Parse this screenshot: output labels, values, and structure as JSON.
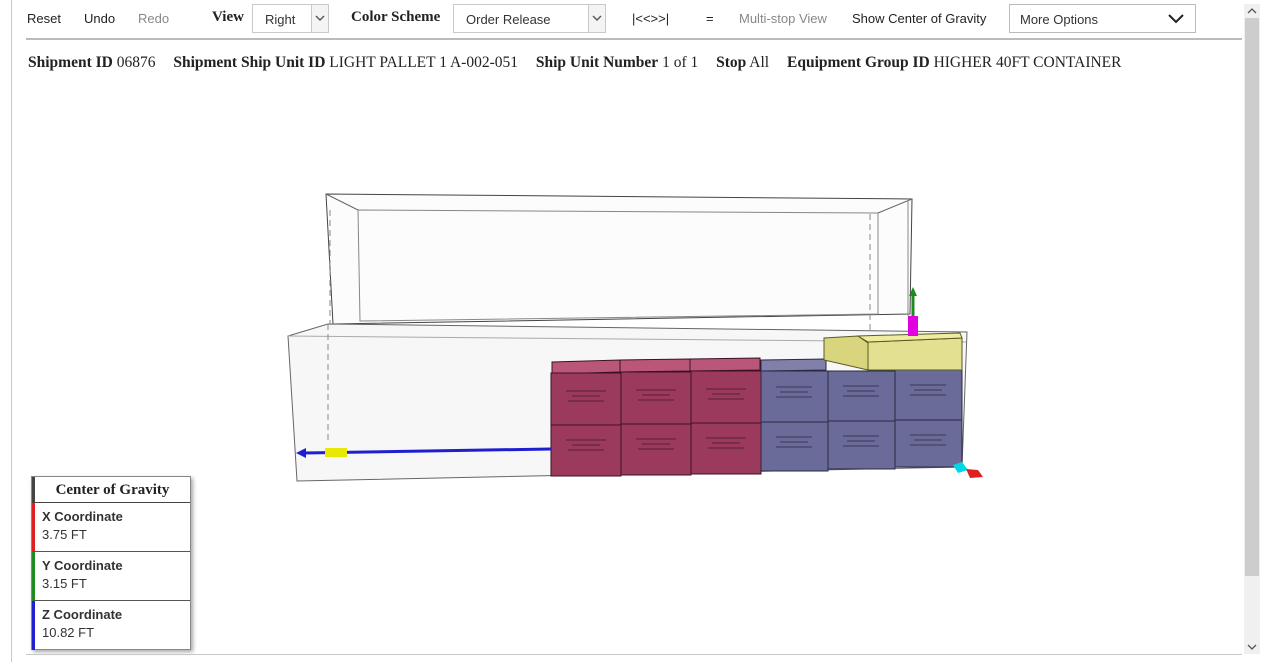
{
  "toolbar": {
    "reset": "Reset",
    "undo": "Undo",
    "redo": "Redo",
    "view_label": "View",
    "view_value": "Right",
    "color_scheme_label": "Color Scheme",
    "color_scheme_value": "Order Release",
    "nav_arrows": "|<<>>|",
    "equals": "=",
    "multistop": "Multi-stop View",
    "show_cog": "Show Center of Gravity",
    "more_options": "More Options"
  },
  "info": {
    "shipment_id_label": "Shipment ID",
    "shipment_id": "06876",
    "ship_unit_id_label": "Shipment Ship Unit ID",
    "ship_unit_id": "LIGHT PALLET 1 A-002-051",
    "ship_unit_number_label": "Ship Unit Number",
    "ship_unit_number": "1 of 1",
    "stop_label": "Stop",
    "stop": "All",
    "equipment_group_label": "Equipment Group ID",
    "equipment_group": "HIGHER 40FT CONTAINER"
  },
  "center_of_gravity": {
    "title": "Center of Gravity",
    "x_label": "X Coordinate",
    "x_value": "3.75 FT",
    "y_label": "Y Coordinate",
    "y_value": "3.15 FT",
    "z_label": "Z Coordinate",
    "z_value": "10.82 FT"
  },
  "colors": {
    "maroon_box": "#9c3a5e",
    "purple_box": "#6b6b99",
    "yellow_box": "#dcd98a",
    "x_axis": "#e02020",
    "y_axis": "#1f8a1f",
    "z_axis": "#1f1fd0",
    "cog_marker_top": "#e000e0",
    "cog_marker_side": "#e8e800",
    "origin_marker": "#00d8e8"
  }
}
